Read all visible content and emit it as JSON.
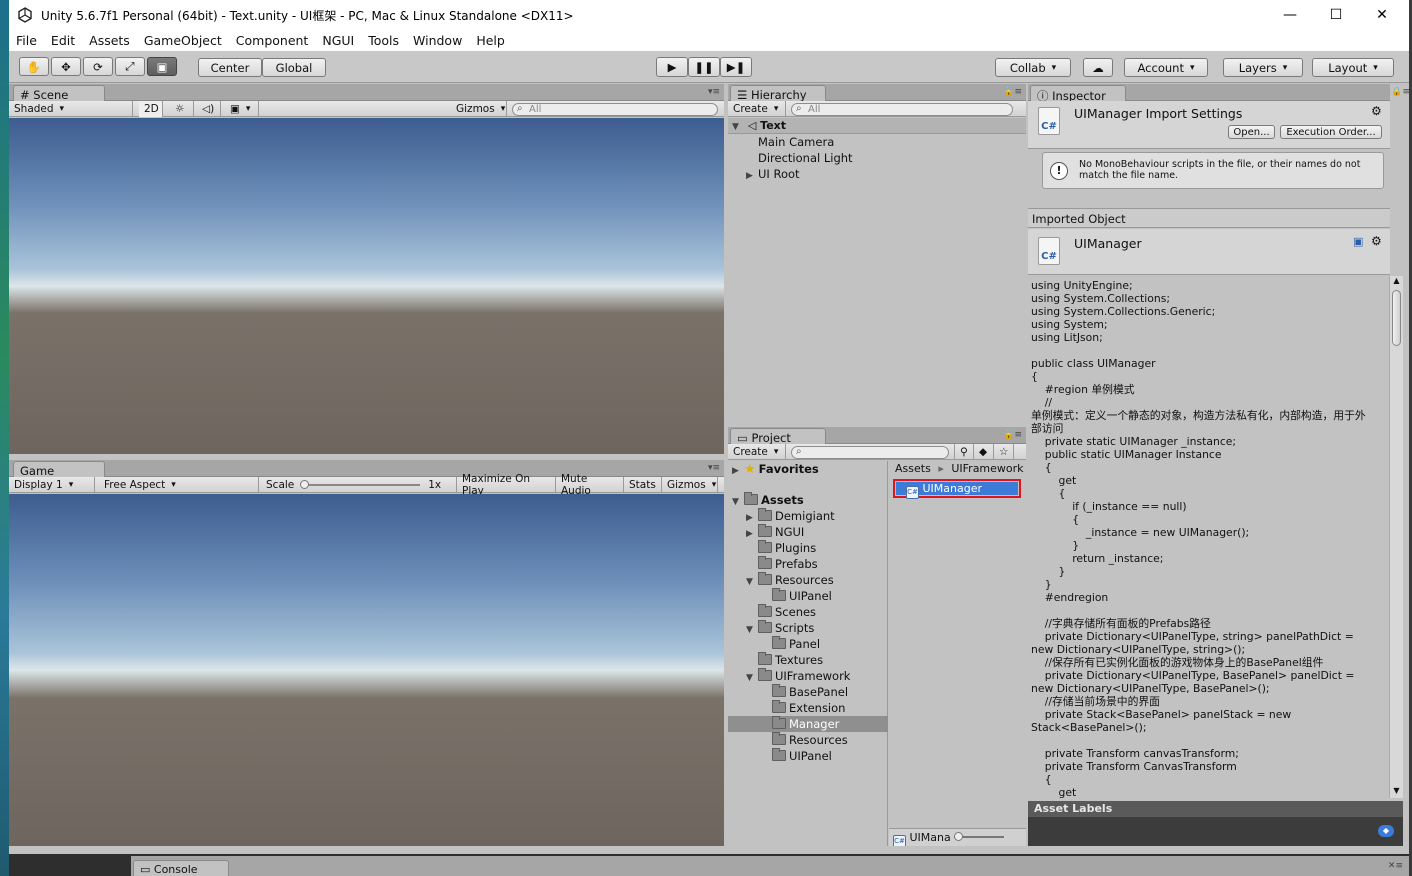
{
  "window": {
    "title": "Unity 5.6.7f1 Personal (64bit) - Text.unity - UI框架 - PC, Mac & Linux Standalone <DX11>",
    "minimize": "—",
    "maximize": "☐",
    "close": "✕"
  },
  "menu": [
    "File",
    "Edit",
    "Assets",
    "GameObject",
    "Component",
    "NGUI",
    "Tools",
    "Window",
    "Help"
  ],
  "toolbar": {
    "transform_tools": [
      "✋",
      "✥",
      "⟳",
      "⤢",
      "▣"
    ],
    "center": "Center",
    "global": "Global",
    "play": "▶",
    "pause": "❚❚",
    "step": "▶❚",
    "collab": "Collab",
    "cloud": "☁",
    "account": "Account",
    "layers": "Layers",
    "layout": "Layout"
  },
  "scene": {
    "tab": "# Scene",
    "shaded": "Shaded",
    "mode2d": "2D",
    "light": "☼",
    "audio": "◁)",
    "fx": "▣",
    "gizmos": "Gizmos",
    "search_placeholder": "All"
  },
  "game": {
    "tab": "Game",
    "display": "Display 1",
    "aspect": "Free Aspect",
    "scale_label": "Scale",
    "scale_value": "1x",
    "maximize": "Maximize On Play",
    "mute": "Mute Audio",
    "stats": "Stats",
    "gizmos": "Gizmos"
  },
  "hierarchy": {
    "tab": "Hierarchy",
    "create": "Create",
    "search_placeholder": "All",
    "scene_name": "Text",
    "items": [
      "Main Camera",
      "Directional Light",
      "UI Root"
    ]
  },
  "project": {
    "tab": "Project",
    "create": "Create",
    "favorites": "Favorites",
    "assets": "Assets",
    "tree": [
      {
        "label": "Demigiant",
        "arrow": "▶"
      },
      {
        "label": "NGUI",
        "arrow": "▶"
      },
      {
        "label": "Plugins",
        "arrow": ""
      },
      {
        "label": "Prefabs",
        "arrow": ""
      },
      {
        "label": "Resources",
        "arrow": "▼"
      },
      {
        "label": "UIPanel",
        "arrow": ""
      },
      {
        "label": "Scenes",
        "arrow": ""
      },
      {
        "label": "Scripts",
        "arrow": "▼"
      },
      {
        "label": "Panel",
        "arrow": ""
      },
      {
        "label": "Textures",
        "arrow": ""
      },
      {
        "label": "UIFramework",
        "arrow": "▼"
      },
      {
        "label": "BasePanel",
        "arrow": ""
      },
      {
        "label": "Extension",
        "arrow": ""
      },
      {
        "label": "Manager",
        "arrow": ""
      },
      {
        "label": "Resources",
        "arrow": ""
      },
      {
        "label": "UIPanel",
        "arrow": ""
      }
    ],
    "breadcrumb_root": "Assets",
    "breadcrumb_sep": "▸",
    "breadcrumb_child": "UIFramework",
    "selected_file": "UIManager",
    "footer_file": "UIMana"
  },
  "inspector": {
    "tab": "Inspector",
    "header_title": "UIManager Import Settings",
    "open_btn": "Open...",
    "exec_order_btn": "Execution Order...",
    "warning": "No MonoBehaviour scripts in the file, or their names do not match the file name.",
    "imported_object": "Imported Object",
    "object_name": "UIManager",
    "cs_badge": "C#",
    "code": "using UnityEngine;\nusing System.Collections;\nusing System.Collections.Generic;\nusing System;\nusing LitJson;\n\npublic class UIManager\n{\n    #region 单例模式\n    //\n单例模式：定义一个静态的对象，构造方法私有化，内部构造，用于外部访问\n    private static UIManager _instance;\n    public static UIManager Instance\n    {\n        get\n        {\n            if (_instance == null)\n            {\n                _instance = new UIManager();\n            }\n            return _instance;\n        }\n    }\n    #endregion\n\n    //字典存储所有面板的Prefabs路径\n    private Dictionary<UIPanelType, string> panelPathDict = new Dictionary<UIPanelType, string>();\n    //保存所有已实例化面板的游戏物体身上的BasePanel组件\n    private Dictionary<UIPanelType, BasePanel> panelDict = new Dictionary<UIPanelType, BasePanel>();\n    //存储当前场景中的界面\n    private Stack<BasePanel> panelStack = new Stack<BasePanel>();\n\n    private Transform canvasTransform;\n    private Transform CanvasTransform\n    {\n        get",
    "asset_labels": "Asset Labels"
  },
  "console": {
    "tab": "Console"
  },
  "colors": {
    "selection": "#3d7bd9",
    "highlight_box": "#e0141e"
  }
}
